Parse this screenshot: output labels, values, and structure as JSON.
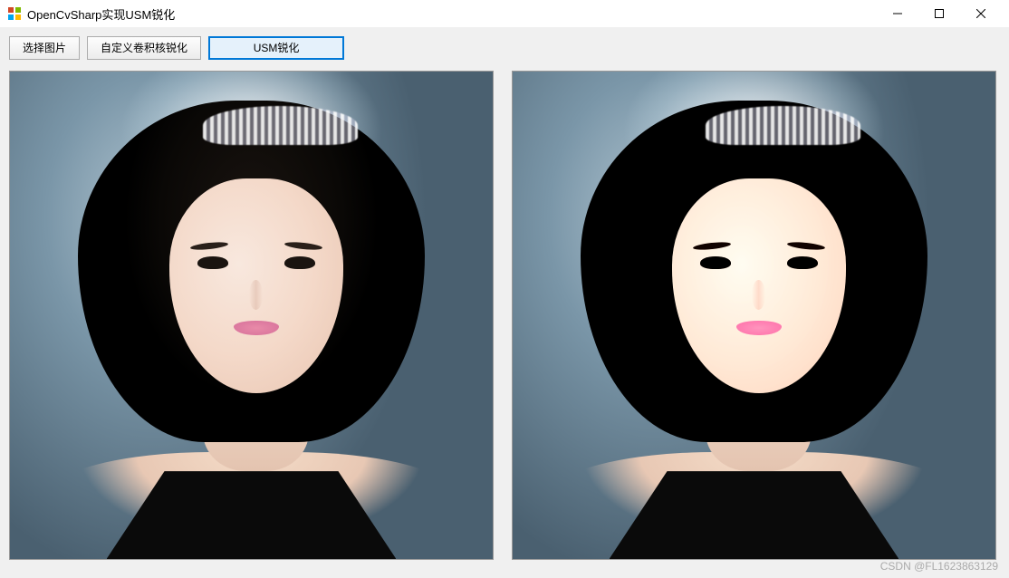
{
  "window": {
    "title": "OpenCvSharp实现USM锐化"
  },
  "toolbar": {
    "select_image_label": "选择图片",
    "custom_kernel_label": "自定义卷积核锐化",
    "usm_sharpen_label": "USM锐化"
  },
  "watermark": "CSDN @FL1623863129"
}
